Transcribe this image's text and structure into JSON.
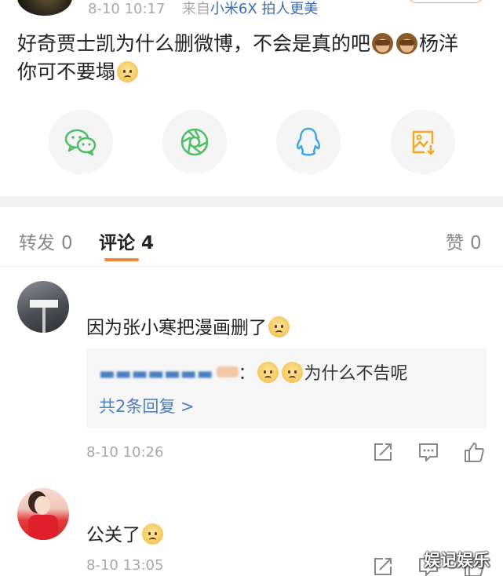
{
  "post": {
    "time": "8-10 10:17",
    "source_prefix": "来自",
    "device": "小米6X 拍人更美",
    "text_part1": "好奇贾士凯为什么删微博，不会是真的吧",
    "text_part2": "杨洋",
    "text_part3": "你可不要塌",
    "emojis": [
      "monkey-emoji",
      "monkey-emoji",
      "sad-emoji"
    ]
  },
  "share": {
    "items": [
      {
        "icon": "wechat-icon",
        "color": "#4cbf64"
      },
      {
        "icon": "moments-icon",
        "color": "#4cbf64"
      },
      {
        "icon": "qq-icon",
        "color": "#3fa7e8"
      },
      {
        "icon": "save-image-icon",
        "color": "#f5a623"
      }
    ]
  },
  "tabs": {
    "repost": {
      "label": "转发",
      "count": "0"
    },
    "comments": {
      "label": "评论",
      "count": "4"
    },
    "likes": {
      "label": "赞",
      "count": "0"
    }
  },
  "comments": [
    {
      "text": "因为张小寒把漫画删了",
      "emoji": "laugh-cry-emoji",
      "time": "8-10 10:26",
      "reply": {
        "separator": "：",
        "text": "为什么不告呢",
        "emojis": [
          "laugh-cry-emoji",
          "laugh-cry-emoji"
        ],
        "more": "共2条回复 >"
      }
    },
    {
      "text": "公关了",
      "emoji": "grin-emoji",
      "time": "8-10 13:05"
    }
  ],
  "watermark": "娱记娱乐",
  "colors": {
    "accent": "#f5883a",
    "link": "#4a7fc1"
  }
}
